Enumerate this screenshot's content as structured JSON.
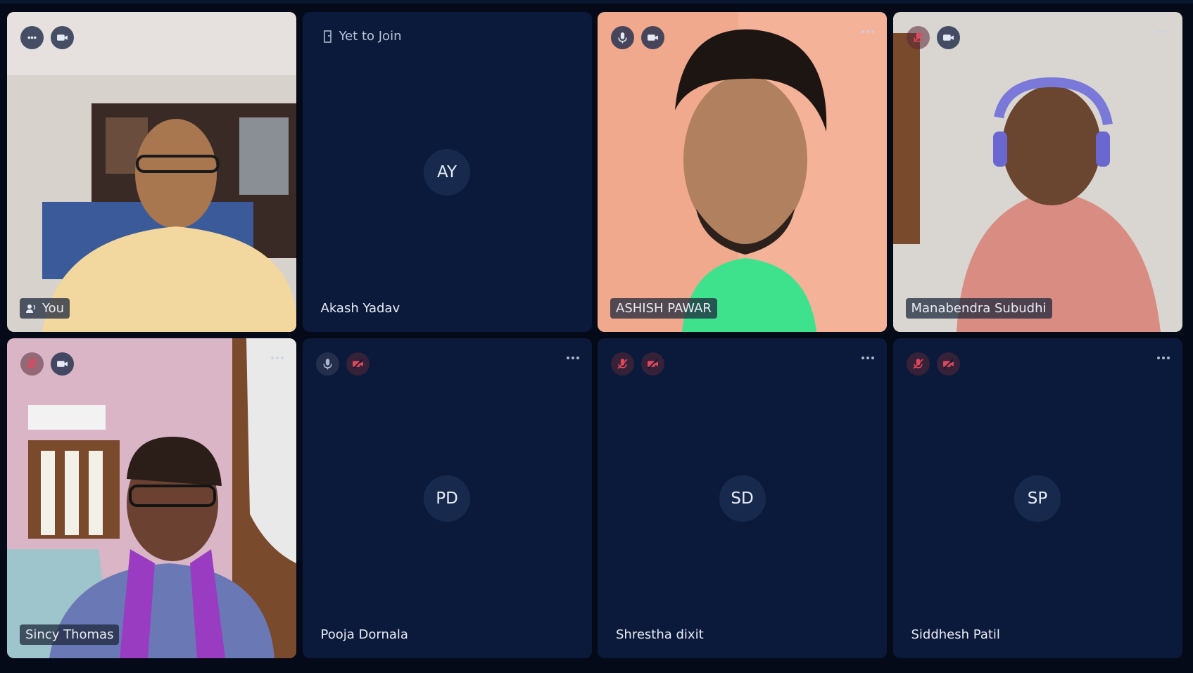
{
  "participants": [
    {
      "name": "You",
      "type": "video",
      "initials": "",
      "status": ""
    },
    {
      "name": "Akash Yadav",
      "type": "avatar",
      "initials": "AY",
      "status": "Yet to Join"
    },
    {
      "name": "ASHISH PAWAR",
      "type": "video",
      "initials": "",
      "status": ""
    },
    {
      "name": "Manabendra Subudhi",
      "type": "video",
      "initials": "",
      "status": ""
    },
    {
      "name": "Sincy Thomas",
      "type": "video",
      "initials": "",
      "status": ""
    },
    {
      "name": "Pooja Dornala",
      "type": "avatar",
      "initials": "PD",
      "status": ""
    },
    {
      "name": "Shrestha dixit",
      "type": "avatar",
      "initials": "SD",
      "status": ""
    },
    {
      "name": "Siddhesh Patil",
      "type": "avatar",
      "initials": "SP",
      "status": ""
    }
  ],
  "icons": {
    "mic_on": "mic-icon",
    "mic_off": "mic-muted-icon",
    "cam_on": "camera-icon",
    "cam_off": "camera-off-icon",
    "more": "more-options-icon",
    "speaking": "speaking-icon",
    "audio_dots": "audio-level-icon",
    "door": "door-icon"
  },
  "colors": {
    "tile_bg": "#0b1a3a",
    "avatar_bg": "#172a4e",
    "muted_red": "#e0485a",
    "page_bg": "#050a18"
  }
}
